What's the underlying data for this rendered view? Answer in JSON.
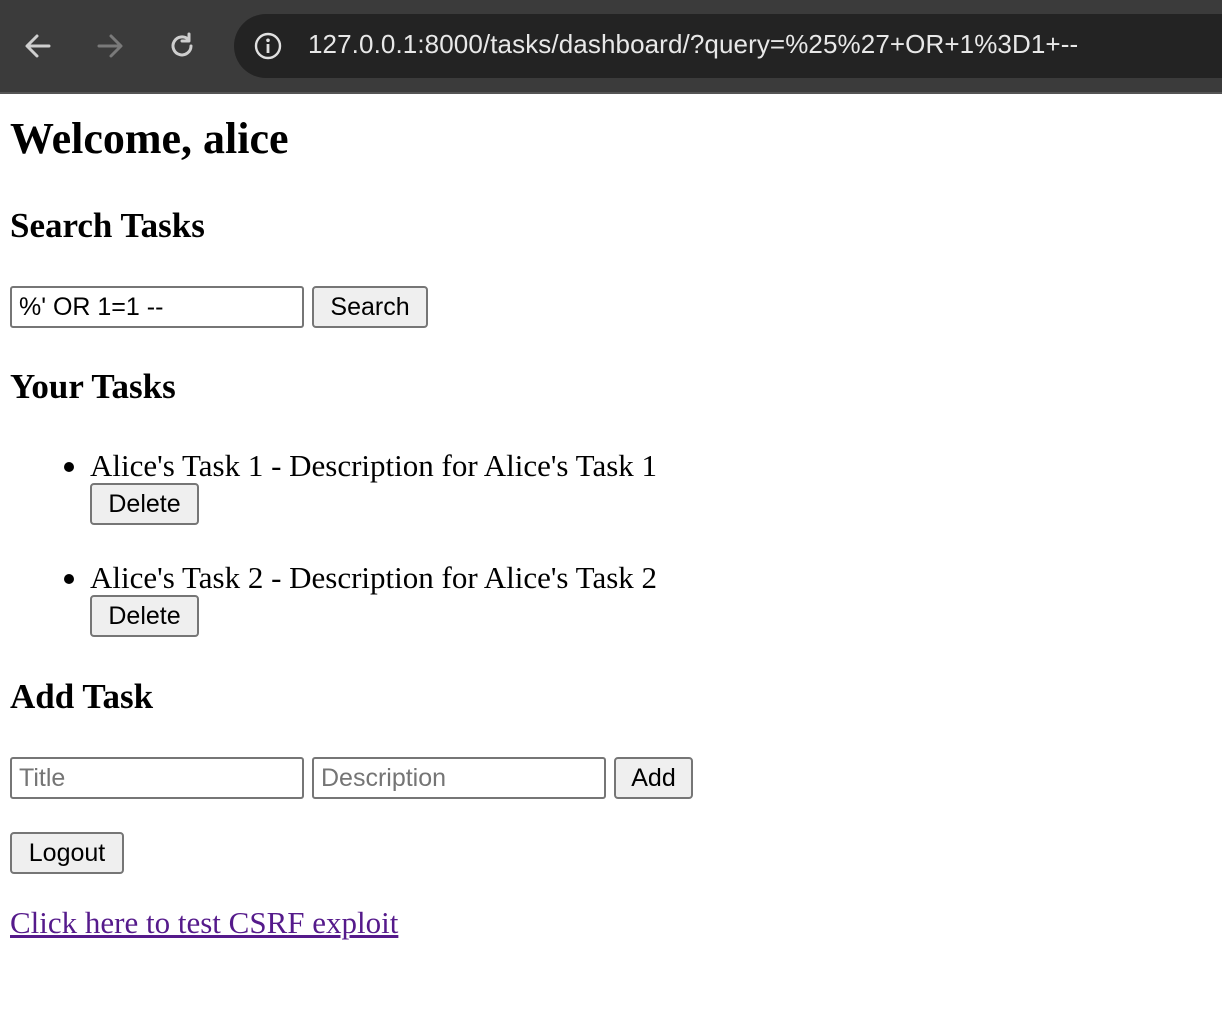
{
  "browser": {
    "url": "127.0.0.1:8000/tasks/dashboard/?query=%25%27+OR+1%3D1+--"
  },
  "page": {
    "welcome": "Welcome, alice",
    "search": {
      "heading": "Search Tasks",
      "query_value": "%' OR 1=1 --",
      "button_label": "Search"
    },
    "tasks": {
      "heading": "Your Tasks",
      "items": [
        {
          "text": "Alice's Task 1 - Description for Alice's Task 1",
          "delete_label": "Delete"
        },
        {
          "text": "Alice's Task 2 - Description for Alice's Task 2",
          "delete_label": "Delete"
        }
      ]
    },
    "add_task": {
      "heading": "Add Task",
      "title_placeholder": "Title",
      "description_placeholder": "Description",
      "button_label": "Add"
    },
    "logout_label": "Logout",
    "csrf_link": "Click here to test CSRF exploit"
  },
  "icons": {
    "back": "arrow-left-icon",
    "forward": "arrow-right-icon",
    "reload": "reload-icon",
    "site_info": "info-icon"
  },
  "colors": {
    "chrome_bg": "#3b3b3b",
    "omnibox_bg": "#232323",
    "link_visited": "#551a8b",
    "button_bg": "#efefef"
  }
}
